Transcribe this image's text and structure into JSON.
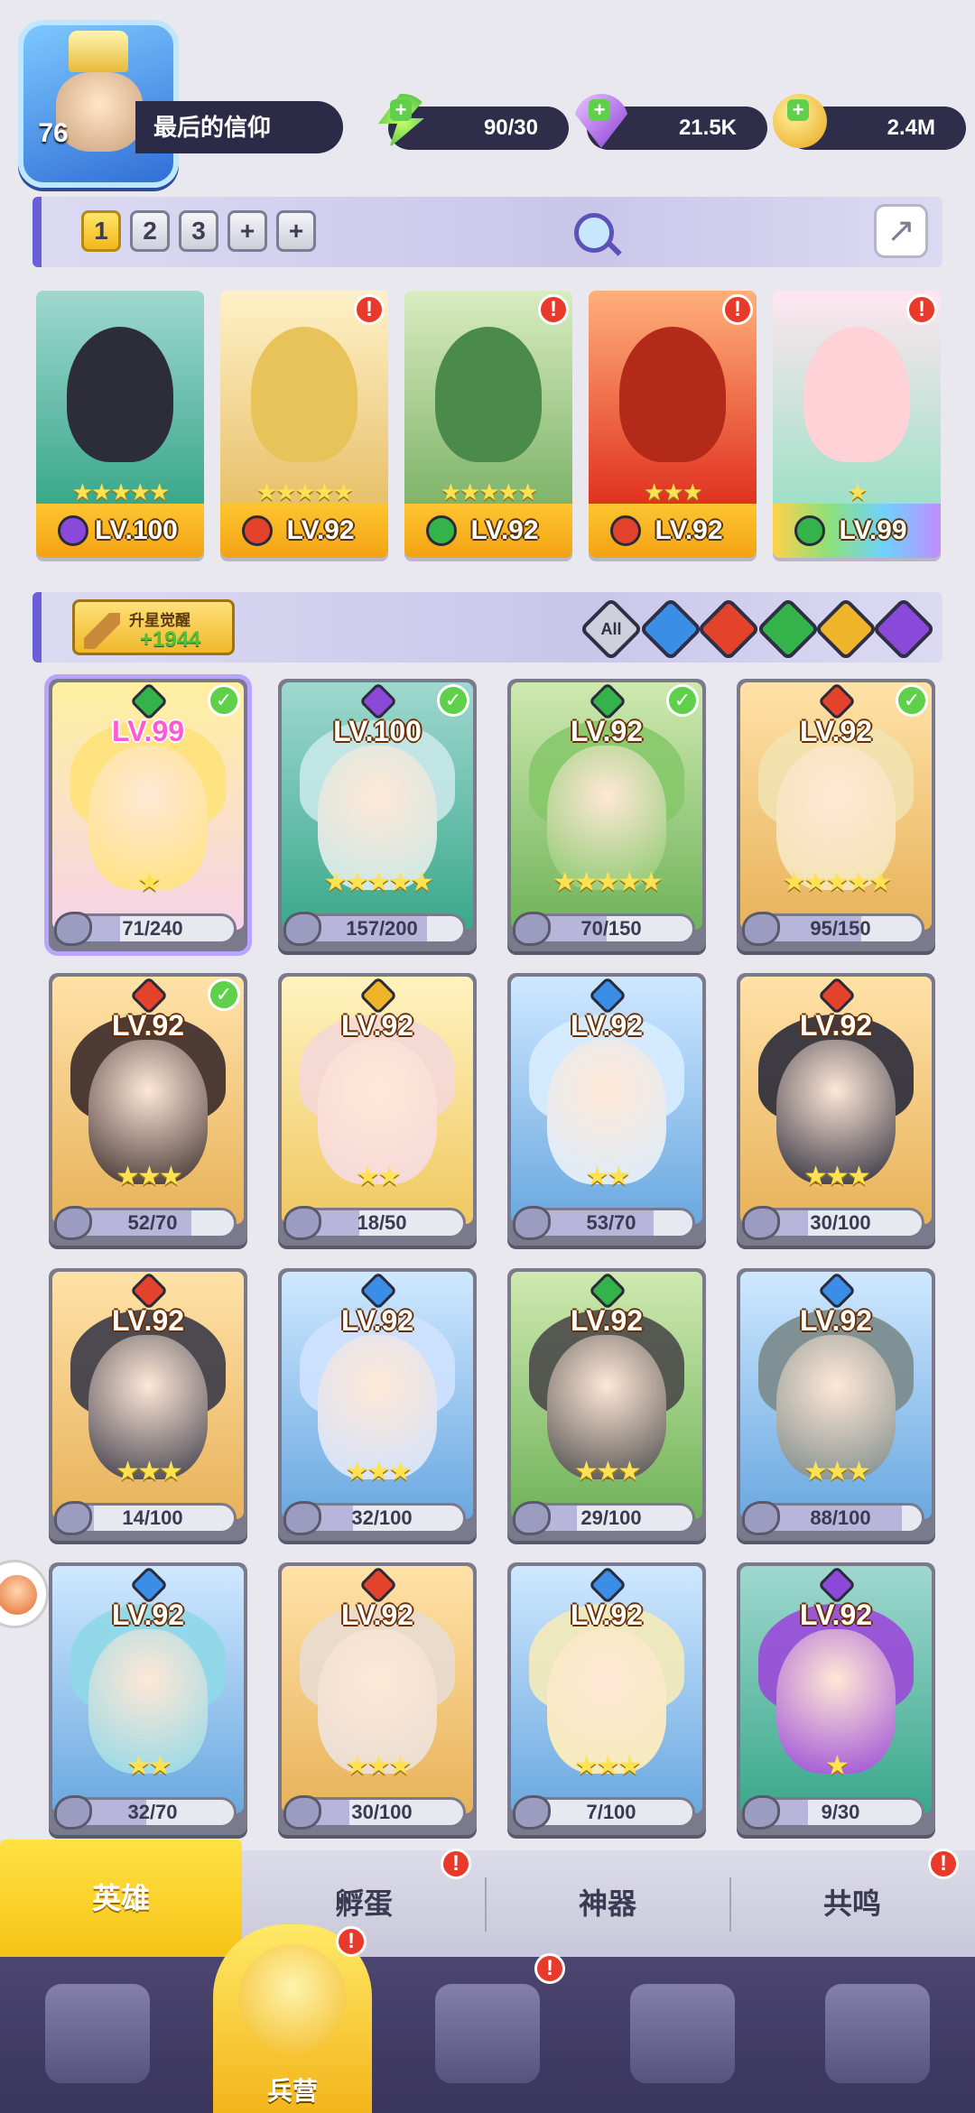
{
  "player": {
    "level": "76",
    "name": "最后的信仰"
  },
  "resources": [
    {
      "icon": "energy-icon",
      "value": "90/30"
    },
    {
      "icon": "gem-icon",
      "value": "21.5K"
    },
    {
      "icon": "coin-icon",
      "value": "2.4M"
    }
  ],
  "team_tabs": [
    "1",
    "2",
    "3",
    "+",
    "+"
  ],
  "team": [
    {
      "level": "LV.100",
      "element": "dark",
      "stars": "★★★★★",
      "alert": false
    },
    {
      "level": "LV.92",
      "element": "fire",
      "stars": "★★★★★",
      "alert": true
    },
    {
      "level": "LV.92",
      "element": "nature",
      "stars": "★★★★★",
      "alert": true
    },
    {
      "level": "LV.92",
      "element": "fire",
      "stars": "★★★",
      "alert": true
    },
    {
      "level": "LV.99",
      "element": "nature",
      "stars": "★",
      "alert": true
    }
  ],
  "awaken": {
    "title": "升星觉醒",
    "count": "+1944"
  },
  "filters": [
    "All",
    "water",
    "fire",
    "nature",
    "light",
    "dark"
  ],
  "heroes": [
    {
      "level": "LV.99",
      "element": "nature",
      "stars": "★",
      "progress": "71/240",
      "fill": 0.3,
      "check": true,
      "selected": true
    },
    {
      "level": "LV.100",
      "element": "dark",
      "stars": "★★★★★",
      "progress": "157/200",
      "fill": 0.78,
      "check": true
    },
    {
      "level": "LV.92",
      "element": "nature",
      "stars": "★★★★★",
      "progress": "70/150",
      "fill": 0.47,
      "check": true
    },
    {
      "level": "LV.92",
      "element": "fire",
      "stars": "★★★★★",
      "progress": "95/150",
      "fill": 0.63,
      "check": true
    },
    {
      "level": "LV.92",
      "element": "fire",
      "stars": "★★★",
      "progress": "52/70",
      "fill": 0.74,
      "check": true
    },
    {
      "level": "LV.92",
      "element": "light",
      "stars": "★★",
      "progress": "18/50",
      "fill": 0.36
    },
    {
      "level": "LV.92",
      "element": "water",
      "stars": "★★",
      "progress": "53/70",
      "fill": 0.76
    },
    {
      "level": "LV.92",
      "element": "fire",
      "stars": "★★★",
      "progress": "30/100",
      "fill": 0.3
    },
    {
      "level": "LV.92",
      "element": "fire",
      "stars": "★★★",
      "progress": "14/100",
      "fill": 0.14
    },
    {
      "level": "LV.92",
      "element": "water",
      "stars": "★★★",
      "progress": "32/100",
      "fill": 0.32
    },
    {
      "level": "LV.92",
      "element": "nature",
      "stars": "★★★",
      "progress": "29/100",
      "fill": 0.29
    },
    {
      "level": "LV.92",
      "element": "water",
      "stars": "★★★",
      "progress": "88/100",
      "fill": 0.88
    },
    {
      "level": "LV.92",
      "element": "water",
      "stars": "★★",
      "progress": "32/70",
      "fill": 0.46
    },
    {
      "level": "LV.92",
      "element": "fire",
      "stars": "★★★",
      "progress": "30/100",
      "fill": 0.3
    },
    {
      "level": "LV.92",
      "element": "water",
      "stars": "★★★",
      "progress": "7/100",
      "fill": 0.07
    },
    {
      "level": "LV.92",
      "element": "dark",
      "stars": "★",
      "progress": "9/30",
      "fill": 0.3
    }
  ],
  "sub_tabs": [
    {
      "label": "英雄",
      "active": true,
      "alert": false
    },
    {
      "label": "孵蛋",
      "alert": true
    },
    {
      "label": "神器",
      "alert": false
    },
    {
      "label": "共鸣",
      "alert": true
    }
  ],
  "bottom_nav": [
    {
      "label": "",
      "icon": "cards-icon"
    },
    {
      "label": "兵营",
      "icon": "barracks-icon",
      "active": true,
      "alert": true
    },
    {
      "label": "",
      "icon": "map-icon",
      "alert": true
    },
    {
      "label": "",
      "icon": "castle-icon"
    },
    {
      "label": "",
      "icon": "mushroom-icon"
    }
  ],
  "colors": {
    "fire": "#e2432a",
    "water": "#3a8ee6",
    "nature": "#34b34a",
    "light": "#f0b42a",
    "dark": "#8a49d8",
    "accent": "#f6c317"
  }
}
